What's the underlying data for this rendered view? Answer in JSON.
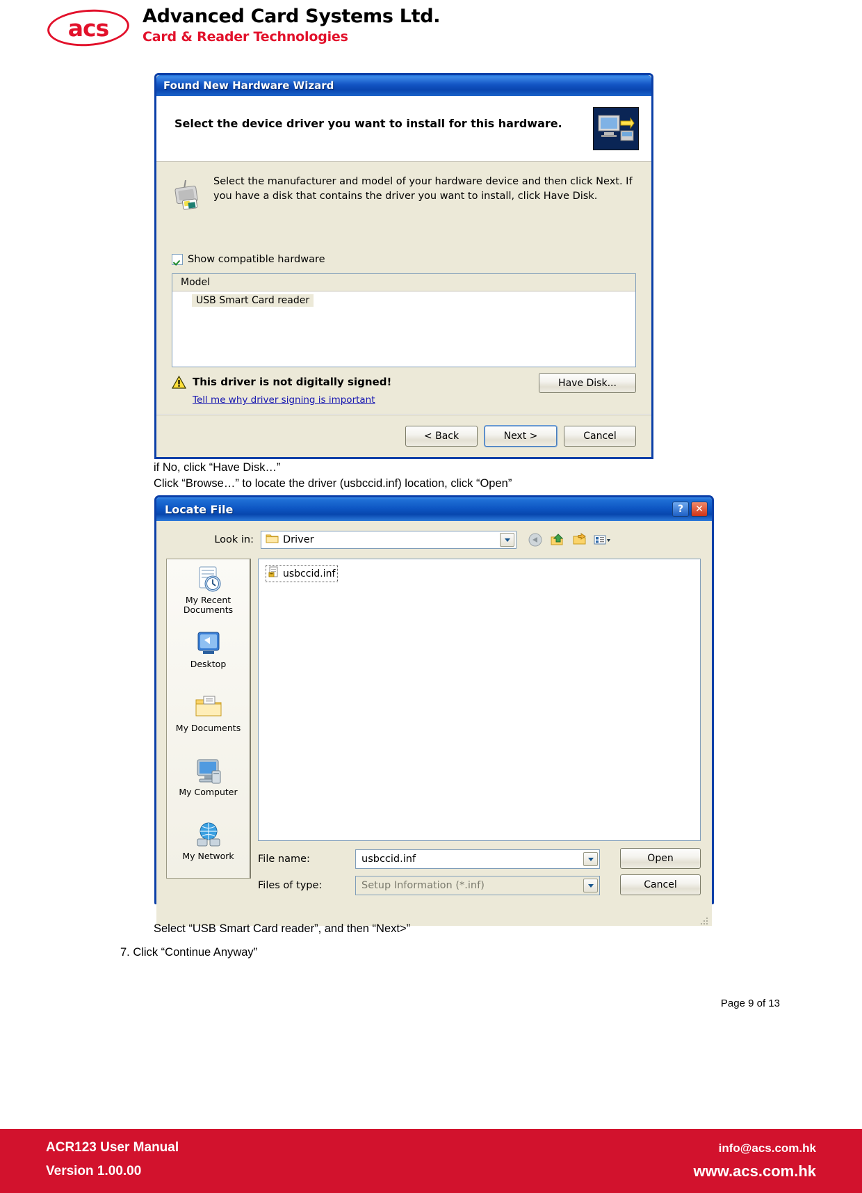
{
  "header": {
    "logo_text": "acs",
    "company_name": "Advanced Card Systems Ltd.",
    "tagline": "Card & Reader Technologies"
  },
  "wizard_dialog": {
    "title": "Found New Hardware Wizard",
    "heading": "Select the device driver you want to install for this hardware.",
    "description": "Select the manufacturer and model of your hardware device and then click Next. If you have a disk that contains the driver you want to install, click Have Disk.",
    "checkbox": {
      "label": "Show compatible hardware",
      "checked": "true"
    },
    "list": {
      "column_header": "Model",
      "rows": [
        "USB Smart Card reader"
      ]
    },
    "warning": {
      "title": "This driver is not digitally signed!",
      "link": "Tell me why driver signing is important"
    },
    "have_disk_label": "Have Disk...",
    "buttons": {
      "back": "< Back",
      "next": "Next >",
      "cancel": "Cancel"
    }
  },
  "captions": {
    "line1": "if No, click “Have Disk…”",
    "line2": "Click “Browse…” to locate the driver (usbccid.inf) location, click “Open”",
    "line3": "Select “USB Smart Card reader”, and then “Next>”",
    "line4": "7.   Click “Continue Anyway”"
  },
  "locate_dialog": {
    "title": "Locate File",
    "caption_buttons": {
      "help": "?",
      "close": "✕"
    },
    "look_in": {
      "label": "Look in:",
      "value": "Driver"
    },
    "toolbar_icons": [
      "back-icon",
      "up-one-level-icon",
      "new-folder-icon",
      "views-icon"
    ],
    "places": [
      {
        "label": "My Recent Documents",
        "icon": "recent-documents-icon"
      },
      {
        "label": "Desktop",
        "icon": "desktop-icon"
      },
      {
        "label": "My Documents",
        "icon": "my-documents-icon"
      },
      {
        "label": "My Computer",
        "icon": "my-computer-icon"
      },
      {
        "label": "My Network",
        "icon": "my-network-icon"
      }
    ],
    "files": [
      {
        "name": "usbccid.inf",
        "icon": "inf-file-icon",
        "selected": "true"
      }
    ],
    "file_name": {
      "label": "File name:",
      "value": "usbccid.inf"
    },
    "files_of_type": {
      "label": "Files of type:",
      "value": "Setup Information (*.inf)"
    },
    "buttons": {
      "open": "Open",
      "cancel": "Cancel"
    }
  },
  "footer": {
    "page_number": "Page 9 of 13",
    "manual_title": "ACR123 User Manual",
    "version": "Version 1.00.00",
    "email": "info@acs.com.hk",
    "website": "www.acs.com.hk",
    "bar_color": "#d2122d"
  }
}
